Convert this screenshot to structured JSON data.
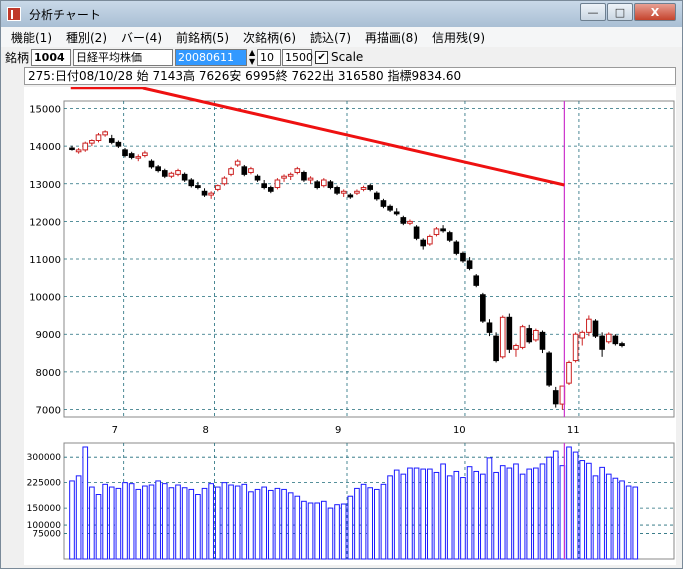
{
  "window": {
    "title": "分析チャート",
    "buttons": {
      "minimize": "—",
      "maximize": "□",
      "close": "X"
    }
  },
  "menu": {
    "items": [
      {
        "label": "機能(1)"
      },
      {
        "label": "種別(2)"
      },
      {
        "label": "バー(4)"
      },
      {
        "label": "前銘柄(5)"
      },
      {
        "label": "次銘柄(6)"
      },
      {
        "label": "読込(7)"
      },
      {
        "label": "再描画(8)"
      },
      {
        "label": "信用残(9)"
      }
    ]
  },
  "toolbar": {
    "brand_label": "銘柄",
    "code": "1004",
    "name": "日経平均株価",
    "date": "20080611",
    "days": "10",
    "range": "1500",
    "scale_checked": "✔",
    "scale_label": "Scale"
  },
  "info": {
    "text": "275:日付08/10/28 始 7143高 7626安 6995終 7622出 316580 指標9834.60"
  },
  "colors": {
    "grid": "#1f6b7a",
    "up_candle": "#cc2222",
    "down_candle": "#000000",
    "volume_bar": "#1a1aff",
    "cursor_line": "#cc33cc",
    "annotation": "#ee1111"
  },
  "chart_data": [
    {
      "type": "candlestick",
      "y_ticks": [
        "15000",
        "14000",
        "13000",
        "12000",
        "11000",
        "10000",
        "9000",
        "8000",
        "7000"
      ],
      "ylim": [
        6800,
        15200
      ],
      "x_ticks": [
        "7",
        "8",
        "9",
        "10",
        "11"
      ],
      "cursor_date": "08/10/28",
      "ohlc": [
        [
          13950,
          14010,
          13880,
          13920
        ],
        [
          13850,
          13950,
          13800,
          13900
        ],
        [
          13900,
          14120,
          13850,
          14080
        ],
        [
          14080,
          14180,
          14000,
          14150
        ],
        [
          14150,
          14350,
          14100,
          14300
        ],
        [
          14300,
          14420,
          14250,
          14380
        ],
        [
          14200,
          14300,
          14050,
          14100
        ],
        [
          14100,
          14150,
          13950,
          14000
        ],
        [
          13900,
          13950,
          13700,
          13750
        ],
        [
          13800,
          13850,
          13650,
          13700
        ],
        [
          13700,
          13780,
          13600,
          13720
        ],
        [
          13750,
          13880,
          13700,
          13820
        ],
        [
          13600,
          13650,
          13400,
          13450
        ],
        [
          13450,
          13500,
          13300,
          13350
        ],
        [
          13350,
          13400,
          13150,
          13200
        ],
        [
          13200,
          13320,
          13150,
          13280
        ],
        [
          13250,
          13400,
          13200,
          13350
        ],
        [
          13250,
          13300,
          13050,
          13100
        ],
        [
          13100,
          13150,
          12900,
          12950
        ],
        [
          12950,
          13050,
          12850,
          12900
        ],
        [
          12800,
          12880,
          12650,
          12700
        ],
        [
          12700,
          12800,
          12600,
          12750
        ],
        [
          12850,
          12980,
          12800,
          12950
        ],
        [
          13000,
          13200,
          12950,
          13150
        ],
        [
          13250,
          13450,
          13200,
          13400
        ],
        [
          13500,
          13650,
          13450,
          13600
        ],
        [
          13450,
          13500,
          13200,
          13250
        ],
        [
          13300,
          13450,
          13250,
          13400
        ],
        [
          13200,
          13250,
          13050,
          13100
        ],
        [
          13000,
          13100,
          12850,
          12900
        ],
        [
          12900,
          12950,
          12750,
          12800
        ],
        [
          12900,
          13150,
          12850,
          13100
        ],
        [
          13150,
          13250,
          13050,
          13200
        ],
        [
          13200,
          13300,
          13100,
          13250
        ],
        [
          13300,
          13450,
          13250,
          13400
        ],
        [
          13300,
          13350,
          13050,
          13100
        ],
        [
          13100,
          13200,
          13000,
          13150
        ],
        [
          13050,
          13100,
          12850,
          12900
        ],
        [
          12950,
          13150,
          12900,
          13100
        ],
        [
          13050,
          13100,
          12850,
          12900
        ],
        [
          12900,
          12950,
          12700,
          12750
        ],
        [
          12750,
          12850,
          12650,
          12800
        ],
        [
          12700,
          12750,
          12600,
          12650
        ],
        [
          12750,
          12850,
          12700,
          12800
        ],
        [
          12850,
          12950,
          12800,
          12900
        ],
        [
          12950,
          13000,
          12800,
          12850
        ],
        [
          12750,
          12800,
          12550,
          12600
        ],
        [
          12550,
          12600,
          12350,
          12400
        ],
        [
          12400,
          12450,
          12250,
          12300
        ],
        [
          12250,
          12350,
          12150,
          12200
        ],
        [
          12100,
          12150,
          11900,
          11950
        ],
        [
          11950,
          12050,
          11900,
          12000
        ],
        [
          11850,
          11900,
          11500,
          11550
        ],
        [
          11500,
          11550,
          11250,
          11350
        ],
        [
          11400,
          11650,
          11350,
          11600
        ],
        [
          11650,
          11850,
          11600,
          11800
        ],
        [
          11800,
          11900,
          11700,
          11750
        ],
        [
          11700,
          11750,
          11450,
          11500
        ],
        [
          11450,
          11500,
          11100,
          11150
        ],
        [
          11150,
          11200,
          10900,
          10950
        ],
        [
          10950,
          11050,
          10700,
          10750
        ],
        [
          10550,
          10600,
          10250,
          10300
        ],
        [
          10050,
          10100,
          9300,
          9350
        ],
        [
          9300,
          9400,
          8950,
          9050
        ],
        [
          8950,
          9050,
          8250,
          8300
        ],
        [
          8400,
          9500,
          8350,
          9450
        ],
        [
          9450,
          9550,
          8500,
          8600
        ],
        [
          8600,
          8750,
          8400,
          8700
        ],
        [
          8650,
          9250,
          8600,
          9200
        ],
        [
          9150,
          9250,
          8750,
          8800
        ],
        [
          8850,
          9150,
          8800,
          9100
        ],
        [
          9050,
          9100,
          8500,
          8600
        ],
        [
          8500,
          8550,
          7600,
          7650
        ],
        [
          7500,
          7600,
          7050,
          7150
        ],
        [
          7143,
          7626,
          6995,
          7622
        ],
        [
          7700,
          8300,
          7650,
          8250
        ],
        [
          8300,
          9050,
          8250,
          9000
        ],
        [
          8900,
          9100,
          8700,
          9050
        ],
        [
          9050,
          9500,
          8950,
          9400
        ],
        [
          9350,
          9400,
          8900,
          8950
        ],
        [
          8950,
          9050,
          8400,
          8600
        ],
        [
          8800,
          9050,
          8750,
          9000
        ],
        [
          8950,
          9000,
          8700,
          8750
        ],
        [
          8750,
          8800,
          8650,
          8700
        ]
      ]
    },
    {
      "type": "bar",
      "y_ticks": [
        "300000",
        "225000",
        "150000",
        "100000",
        "75000"
      ],
      "ylim": [
        0,
        330000
      ],
      "values": [
        230000,
        245000,
        330000,
        212000,
        190000,
        220000,
        212000,
        208000,
        225000,
        222000,
        205000,
        215000,
        218000,
        230000,
        222000,
        210000,
        218000,
        210000,
        205000,
        190000,
        208000,
        222000,
        212000,
        225000,
        218000,
        215000,
        220000,
        198000,
        205000,
        212000,
        202000,
        208000,
        205000,
        195000,
        185000,
        170000,
        165000,
        165000,
        170000,
        150000,
        160000,
        162000,
        185000,
        208000,
        220000,
        210000,
        205000,
        220000,
        245000,
        262000,
        250000,
        268000,
        268000,
        265000,
        265000,
        255000,
        280000,
        245000,
        258000,
        240000,
        272000,
        258000,
        250000,
        298000,
        255000,
        275000,
        268000,
        280000,
        250000,
        265000,
        268000,
        280000,
        300000,
        318000,
        275000,
        330000,
        315000,
        290000,
        282000,
        245000,
        270000,
        250000,
        238000,
        230000,
        215000,
        212000
      ]
    }
  ]
}
